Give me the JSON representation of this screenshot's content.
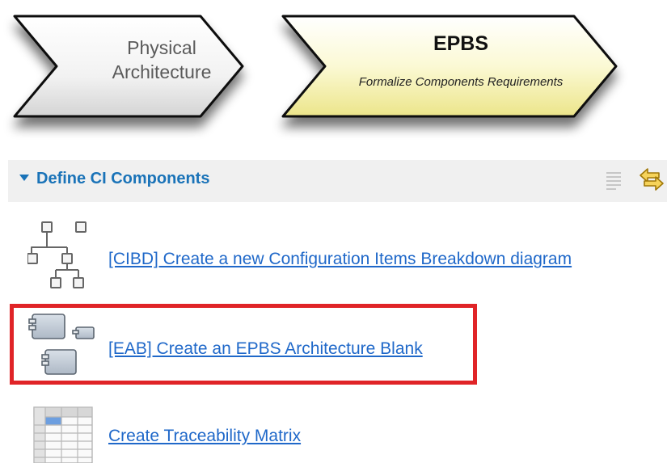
{
  "process_steps": [
    {
      "title": "Physical\nArchitecture",
      "subtitle": ""
    },
    {
      "title": "EPBS",
      "subtitle": "Formalize Components Requirements"
    }
  ],
  "section": {
    "title": "Define CI Components",
    "expanded": true
  },
  "actions": [
    {
      "label": "[CIBD] Create a new Configuration Items Breakdown diagram",
      "icon": "breakdown-diagram-icon"
    },
    {
      "label": "[EAB] Create an EPBS Architecture Blank",
      "icon": "architecture-blank-icon"
    },
    {
      "label": "Create Traceability Matrix",
      "icon": "traceability-matrix-icon"
    }
  ],
  "colors": {
    "link": "#1f68c9",
    "section_title": "#1a73b8",
    "highlight": "#e02427",
    "active_step": "#fbf9d4"
  }
}
